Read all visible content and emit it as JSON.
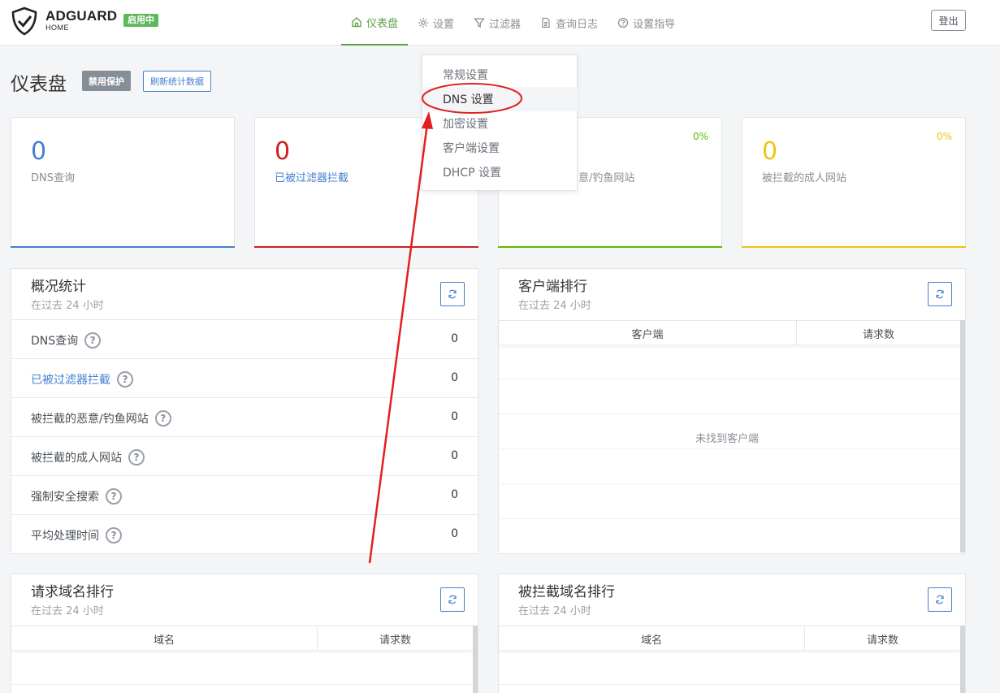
{
  "app": {
    "brand_name": "ADGUARD",
    "brand_sub": "HOME",
    "status_badge": "启用中",
    "logout_label": "登出"
  },
  "nav": {
    "items": [
      {
        "label": "仪表盘",
        "icon": "home-icon",
        "active": true
      },
      {
        "label": "设置",
        "icon": "gear-icon",
        "active": false
      },
      {
        "label": "过滤器",
        "icon": "filter-icon",
        "active": false
      },
      {
        "label": "查询日志",
        "icon": "document-icon",
        "active": false
      },
      {
        "label": "设置指导",
        "icon": "help-icon",
        "active": false
      }
    ]
  },
  "settings_dropdown": {
    "items": [
      "常规设置",
      "DNS 设置",
      "加密设置",
      "客户端设置",
      "DHCP 设置"
    ],
    "highlighted": "DNS 设置"
  },
  "page": {
    "title": "仪表盘",
    "disable_protection_label": "禁用保护",
    "refresh_stats_label": "刷新统计数据"
  },
  "stat_cards": [
    {
      "value": "0",
      "label": "DNS查询",
      "percent": "",
      "color": "#467fcf"
    },
    {
      "value": "0",
      "label": "已被过滤器拦截",
      "percent": "",
      "color": "#cd201f"
    },
    {
      "value": "",
      "label": "被拦截的恶意/钓鱼网站",
      "visible_label": "意/钓鱼网站",
      "percent": "0%",
      "color": "#5eba00"
    },
    {
      "value": "0",
      "label": "被拦截的成人网站",
      "percent": "0%",
      "color": "#f1c40f"
    }
  ],
  "general_stats": {
    "title": "概况统计",
    "subtitle": "在过去 24 小时",
    "rows": [
      {
        "label": "DNS查询",
        "value": "0"
      },
      {
        "label": "已被过滤器拦截",
        "value": "0"
      },
      {
        "label": "被拦截的恶意/钓鱼网站",
        "value": "0"
      },
      {
        "label": "被拦截的成人网站",
        "value": "0"
      },
      {
        "label": "强制安全搜索",
        "value": "0"
      },
      {
        "label": "平均处理时间",
        "value": "0"
      }
    ]
  },
  "top_clients": {
    "title": "客户端排行",
    "subtitle": "在过去 24 小时",
    "columns": [
      "客户端",
      "请求数"
    ],
    "empty_text": "未找到客户端"
  },
  "top_queried": {
    "title": "请求域名排行",
    "subtitle": "在过去 24 小时",
    "columns": [
      "域名",
      "请求数"
    ]
  },
  "top_blocked": {
    "title": "被拦截域名排行",
    "subtitle": "在过去 24 小时",
    "columns": [
      "域名",
      "请求数"
    ]
  },
  "colors": {
    "accent_green": "#5a9e46",
    "primary_blue": "#467fcf",
    "annotation_red": "#e02020"
  }
}
